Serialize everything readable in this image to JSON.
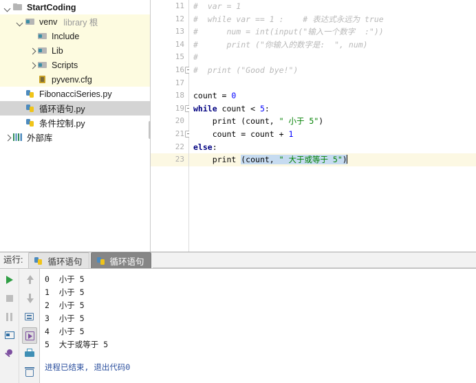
{
  "tree": {
    "items": [
      {
        "label": "StartCoding",
        "sub": "",
        "indent": 0,
        "arrow": "down",
        "icon": "folder",
        "bold": true,
        "state": "normal"
      },
      {
        "label": "venv",
        "sub": "library 根",
        "indent": 1,
        "arrow": "down",
        "icon": "folder-venv",
        "bold": false,
        "state": "venvgroup"
      },
      {
        "label": "Include",
        "sub": "",
        "indent": 2,
        "arrow": "none",
        "icon": "folder-venv",
        "bold": false,
        "state": "venvgroup"
      },
      {
        "label": "Lib",
        "sub": "",
        "indent": 2,
        "arrow": "right",
        "icon": "folder-venv",
        "bold": false,
        "state": "venvgroup"
      },
      {
        "label": "Scripts",
        "sub": "",
        "indent": 2,
        "arrow": "right",
        "icon": "folder-venv",
        "bold": false,
        "state": "venvgroup"
      },
      {
        "label": "pyvenv.cfg",
        "sub": "",
        "indent": 2,
        "arrow": "none",
        "icon": "cfg",
        "bold": false,
        "state": "venvgroup"
      },
      {
        "label": "FibonacciSeries.py",
        "sub": "",
        "indent": 1,
        "arrow": "none",
        "icon": "py",
        "bold": false,
        "state": "normal"
      },
      {
        "label": "循环语句.py",
        "sub": "",
        "indent": 1,
        "arrow": "none",
        "icon": "py",
        "bold": false,
        "state": "selected"
      },
      {
        "label": "条件控制.py",
        "sub": "",
        "indent": 1,
        "arrow": "none",
        "icon": "py",
        "bold": false,
        "state": "normal"
      },
      {
        "label": "外部库",
        "sub": "",
        "indent": 0,
        "arrow": "right",
        "icon": "lib",
        "bold": false,
        "state": "normal"
      }
    ]
  },
  "editor": {
    "first_line_number": 11,
    "current_line": 23,
    "lines": [
      {
        "n": 11,
        "fold": false,
        "tokens": [
          {
            "t": "#  var = 1",
            "c": "cm"
          }
        ]
      },
      {
        "n": 12,
        "fold": false,
        "tokens": [
          {
            "t": "#  while var == 1 :    # 表达式永远为 true",
            "c": "cm"
          }
        ]
      },
      {
        "n": 13,
        "fold": false,
        "tokens": [
          {
            "t": "#      num = int(input(\"输入一个数字  :\"))",
            "c": "cm"
          }
        ]
      },
      {
        "n": 14,
        "fold": false,
        "tokens": [
          {
            "t": "#      print (\"你输入的数字是:  \", num)",
            "c": "cm"
          }
        ]
      },
      {
        "n": 15,
        "fold": false,
        "tokens": [
          {
            "t": "#",
            "c": "cm"
          }
        ]
      },
      {
        "n": 16,
        "fold": true,
        "tokens": [
          {
            "t": "#  print (\"Good bye!\")",
            "c": "cm"
          }
        ]
      },
      {
        "n": 17,
        "fold": false,
        "tokens": []
      },
      {
        "n": 18,
        "fold": false,
        "tokens": [
          {
            "t": "count = ",
            "c": "pl"
          },
          {
            "t": "0",
            "c": "num"
          }
        ]
      },
      {
        "n": 19,
        "fold": true,
        "tokens": [
          {
            "t": "while",
            "c": "kw"
          },
          {
            "t": " count < ",
            "c": "pl"
          },
          {
            "t": "5",
            "c": "num"
          },
          {
            "t": ":",
            "c": "pl"
          }
        ]
      },
      {
        "n": 20,
        "fold": false,
        "tokens": [
          {
            "t": "    print (count, ",
            "c": "pl"
          },
          {
            "t": "\" 小于 5\"",
            "c": "str"
          },
          {
            "t": ")",
            "c": "pl"
          }
        ]
      },
      {
        "n": 21,
        "fold": true,
        "tokens": [
          {
            "t": "    count = count + ",
            "c": "pl"
          },
          {
            "t": "1",
            "c": "num"
          }
        ]
      },
      {
        "n": 22,
        "fold": false,
        "tokens": [
          {
            "t": "else",
            "c": "kw"
          },
          {
            "t": ":",
            "c": "pl"
          }
        ]
      },
      {
        "n": 23,
        "fold": false,
        "tokens": [
          {
            "t": "    print ",
            "c": "pl"
          },
          {
            "t": "(count, ",
            "c": "pl sel"
          },
          {
            "t": "\" 大于或等于 5\"",
            "c": "str sel"
          },
          {
            "t": ")",
            "c": "pl sel"
          }
        ]
      }
    ]
  },
  "run_panel": {
    "title": "运行:",
    "tabs": [
      {
        "label": "循环语句",
        "icon": "py-gray-icon",
        "active": false
      },
      {
        "label": "循环语句",
        "icon": "py-icon",
        "active": true
      }
    ],
    "tools_left": [
      {
        "name": "run-button",
        "icon": "run-icon"
      },
      {
        "name": "stop-button",
        "icon": "stop-icon"
      },
      {
        "name": "pause-button",
        "icon": "pause-icon"
      },
      {
        "name": "console-button",
        "icon": "console-icon"
      },
      {
        "name": "pin-button",
        "icon": "pin-icon"
      }
    ],
    "tools_right": [
      {
        "name": "scroll-up-button",
        "icon": "arrow-up-icon",
        "pressed": false
      },
      {
        "name": "scroll-down-button",
        "icon": "arrow-down-icon",
        "pressed": false
      },
      {
        "name": "soft-wrap-button",
        "icon": "wrap-icon",
        "pressed": false
      },
      {
        "name": "scroll-to-end-button",
        "icon": "scroll-end-icon",
        "pressed": true
      },
      {
        "name": "print-button",
        "icon": "print-icon",
        "pressed": false
      },
      {
        "name": "clear-all-button",
        "icon": "trash-icon",
        "pressed": false
      }
    ],
    "console_lines": [
      "0  小于 5",
      "1  小于 5",
      "2  小于 5",
      "3  小于 5",
      "4  小于 5",
      "5  大于或等于 5"
    ],
    "exit_message": "进程已结束, 退出代码0"
  },
  "colors": {
    "keyword": "#000080",
    "string": "#008000",
    "number": "#0000ff",
    "comment": "#b9b9b9",
    "current_line": "#fcf8e3",
    "selection": "#c6dbf0",
    "tree_selected": "#d4d4d4",
    "venv_group": "#fdfbe0",
    "exit_text": "#2b4f9e",
    "run_green": "#2f9e44"
  }
}
